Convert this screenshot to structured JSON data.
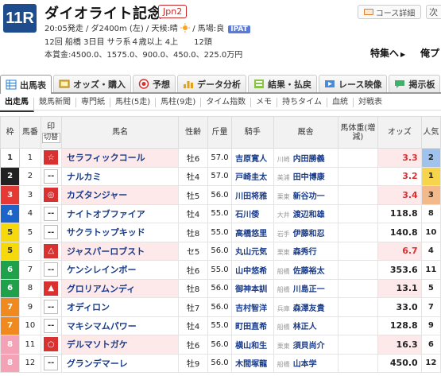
{
  "race": {
    "number": "11R",
    "title": "ダイオライト記念",
    "grade": "Jpn2",
    "info_line": "20:05発走 / ダ2400m (左) / 天候:晴",
    "track_condition": "/ 馬場:良",
    "ipat": "IPAT",
    "meta_line": "12回 船橋 3日目 サラ系４歳以上 4上　　12頭",
    "prize_line": "本賞金:4500.0、1575.0、900.0、450.0、225.0万円"
  },
  "header_actions": {
    "course_label": "コース詳細",
    "next_label": "次",
    "special_label": "特集へ",
    "next_race_label": "俺プ"
  },
  "tabs": [
    {
      "label": "出馬表",
      "icon": "table-icon"
    },
    {
      "label": "オッズ・購入",
      "icon": "odds-icon"
    },
    {
      "label": "予想",
      "icon": "target-icon"
    },
    {
      "label": "データ分析",
      "icon": "bar-chart-icon"
    },
    {
      "label": "結果・払戻",
      "icon": "result-icon"
    },
    {
      "label": "レース映像",
      "icon": "video-icon"
    },
    {
      "label": "掲示板",
      "icon": "chat-icon"
    }
  ],
  "subtabs": [
    "出走馬",
    "競馬新聞",
    "専門紙",
    "馬柱(5走)",
    "馬柱(9走)",
    "タイム指数",
    "メモ",
    "持ちタイム",
    "血統",
    "対戦表"
  ],
  "columns": {
    "waku": "枠",
    "umaban": "馬番",
    "mark": "印",
    "mark_toggle": "切替",
    "horse": "馬名",
    "seirei": "性齢",
    "kin": "斤量",
    "jockey": "騎手",
    "trainer": "厩舎",
    "weight": "馬体重(増減)",
    "odds": "オッズ",
    "pop": "人気"
  },
  "rows": [
    {
      "waku": "1",
      "umaban": "1",
      "mark": "☆",
      "mark_style": "red",
      "horse": "セラフィックコール",
      "seirei": "牡6",
      "kin": "57.0",
      "jockey": "吉原寛人",
      "region": "川崎",
      "trainer": "内田勝義",
      "odds": "3.3",
      "odds_hi": true,
      "pop": "2",
      "pop_class": "p2"
    },
    {
      "waku": "2",
      "umaban": "2",
      "mark": "--",
      "mark_style": "dash",
      "horse": "ナルカミ",
      "seirei": "牡4",
      "kin": "57.0",
      "jockey": "戸崎圭太",
      "region": "美浦",
      "trainer": "田中博康",
      "odds": "3.2",
      "odds_hi": true,
      "pop": "1",
      "pop_class": "p1"
    },
    {
      "waku": "3",
      "umaban": "3",
      "mark": "◎",
      "mark_style": "red",
      "horse": "カズタンジャー",
      "seirei": "牡5",
      "kin": "56.0",
      "jockey": "川田将雅",
      "region": "栗東",
      "trainer": "新谷功一",
      "odds": "3.4",
      "odds_hi": true,
      "pop": "3",
      "pop_class": "p3"
    },
    {
      "waku": "4",
      "umaban": "4",
      "mark": "--",
      "mark_style": "dash",
      "horse": "ナイトオブファイア",
      "seirei": "牡4",
      "kin": "55.0",
      "jockey": "石川倭",
      "region": "大井",
      "trainer": "渡辺和雄",
      "odds": "118.8",
      "odds_hi": false,
      "pop": "8",
      "pop_class": ""
    },
    {
      "waku": "5",
      "umaban": "5",
      "mark": "--",
      "mark_style": "dash",
      "horse": "サクラトップキッド",
      "seirei": "牡8",
      "kin": "55.0",
      "jockey": "高橋悠里",
      "region": "岩手",
      "trainer": "伊藤和忍",
      "odds": "140.8",
      "odds_hi": false,
      "pop": "10",
      "pop_class": ""
    },
    {
      "waku": "5",
      "umaban": "6",
      "mark": "△",
      "mark_style": "red",
      "horse": "ジャスパーロブスト",
      "seirei": "セ5",
      "kin": "56.0",
      "jockey": "丸山元気",
      "region": "栗東",
      "trainer": "森秀行",
      "odds": "6.7",
      "odds_hi": true,
      "pop": "4",
      "pop_class": ""
    },
    {
      "waku": "6",
      "umaban": "7",
      "mark": "--",
      "mark_style": "dash",
      "horse": "ケンシレインボー",
      "seirei": "牡6",
      "kin": "55.0",
      "jockey": "山中悠希",
      "region": "船橋",
      "trainer": "佐藤裕太",
      "odds": "353.6",
      "odds_hi": false,
      "pop": "11",
      "pop_class": ""
    },
    {
      "waku": "6",
      "umaban": "8",
      "mark": "▲",
      "mark_style": "red",
      "horse": "グロリアムンディ",
      "seirei": "牡8",
      "kin": "56.0",
      "jockey": "御神本訓",
      "region": "船橋",
      "trainer": "川島正一",
      "odds": "13.1",
      "odds_hi": false,
      "pop": "5",
      "pop_class": ""
    },
    {
      "waku": "7",
      "umaban": "9",
      "mark": "--",
      "mark_style": "dash",
      "horse": "オディロン",
      "seirei": "牡7",
      "kin": "56.0",
      "jockey": "吉村智洋",
      "region": "兵庫",
      "trainer": "森澤友貴",
      "odds": "33.0",
      "odds_hi": false,
      "pop": "7",
      "pop_class": ""
    },
    {
      "waku": "7",
      "umaban": "10",
      "mark": "--",
      "mark_style": "dash",
      "horse": "マキシマムパワー",
      "seirei": "牡4",
      "kin": "55.0",
      "jockey": "町田直希",
      "region": "船橋",
      "trainer": "林正人",
      "odds": "128.8",
      "odds_hi": false,
      "pop": "9",
      "pop_class": ""
    },
    {
      "waku": "8",
      "umaban": "11",
      "mark": "○",
      "mark_style": "red",
      "horse": "デルマソトガケ",
      "seirei": "牡6",
      "kin": "56.0",
      "jockey": "横山和生",
      "region": "栗東",
      "trainer": "須貝尚介",
      "odds": "16.3",
      "odds_hi": false,
      "pop": "6",
      "pop_class": ""
    },
    {
      "waku": "8",
      "umaban": "12",
      "mark": "--",
      "mark_style": "dash",
      "horse": "グランデマーレ",
      "seirei": "牡9",
      "kin": "56.0",
      "jockey": "木間塚龍",
      "region": "船橋",
      "trainer": "山本学",
      "odds": "450.0",
      "odds_hi": false,
      "pop": "12",
      "pop_class": ""
    }
  ],
  "colors": {
    "race_badge": "#1e4c8c",
    "grade_red": "#c62828",
    "link_blue": "#1a3c8a",
    "odds_red": "#d93030"
  }
}
